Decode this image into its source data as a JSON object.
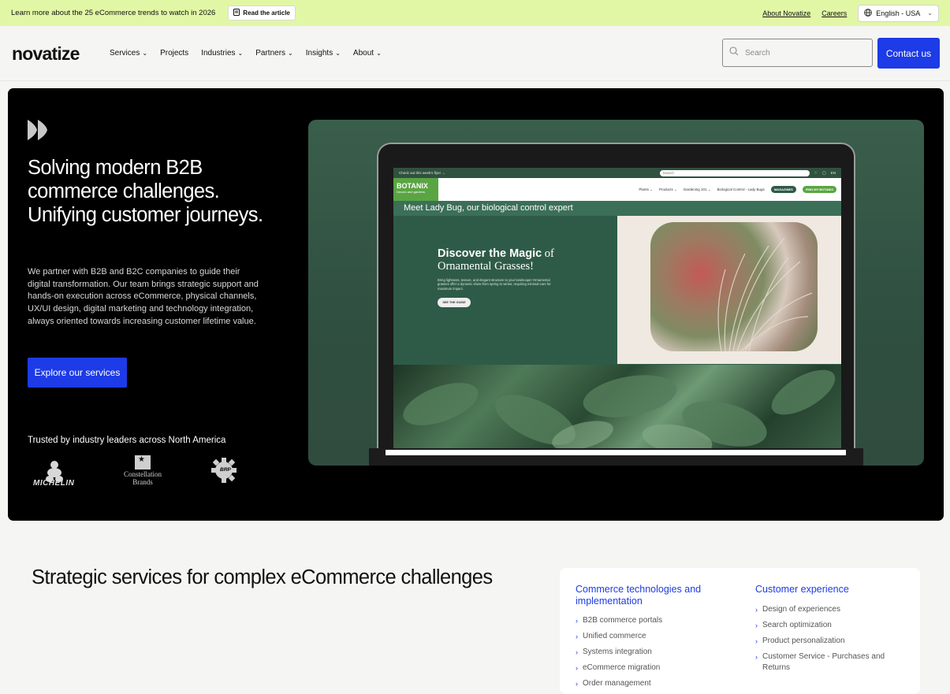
{
  "announcement": {
    "message": "Learn more about the 25 eCommerce trends to watch in 2026",
    "read_label": "Read the article",
    "links": [
      "About Novatize",
      "Careers"
    ],
    "language": "English - USA"
  },
  "header": {
    "logo": "novatize",
    "nav": [
      {
        "label": "Services",
        "has_dropdown": true
      },
      {
        "label": "Projects",
        "has_dropdown": false
      },
      {
        "label": "Industries",
        "has_dropdown": true
      },
      {
        "label": "Partners",
        "has_dropdown": true
      },
      {
        "label": "Insights",
        "has_dropdown": true
      },
      {
        "label": "About",
        "has_dropdown": true
      }
    ],
    "search_placeholder": "Search",
    "contact_label": "Contact us"
  },
  "hero": {
    "headline": "Solving modern B2B commerce challenges. Unifying customer journeys.",
    "body": "We partner with B2B and B2C companies to guide their digital transformation. Our team brings strategic support and hands-on execution across eCommerce, physical channels, UX/UI design, digital marketing and technology integration, always oriented towards increasing customer lifetime value.",
    "cta": "Explore our services",
    "trusted": "Trusted by industry leaders across North America",
    "brands": {
      "michelin": "MICHELIN",
      "constellation_1": "Constellation",
      "constellation_2": "Brands",
      "brp": "BRP"
    }
  },
  "mockup": {
    "topbar": "Check out this week's flyer →",
    "search": "Search",
    "store_name": "BOTANIX",
    "store_tagline": "Decors and gardens",
    "links": [
      "Plants ⌄",
      "Products ⌄",
      "Gardening 101 ⌄",
      "Biological Control - Lady Bugs"
    ],
    "magazines": "MAGAZINES",
    "find": "FIND MY BOTANIX",
    "lang": "EN",
    "banner": "Meet Lady Bug, our biological control expert",
    "promo_bold": "Discover the Magic",
    "promo_of": "of",
    "promo_line2": "Ornamental Grasses!",
    "promo_text": "Bring lightness, texture, and elegant structure to your landscape! Ornamental grasses offer a dynamic show from spring to winter, requiring minimal care for maximum impact.",
    "promo_btn": "SEE THE GUIDE"
  },
  "services": {
    "title": "Strategic services for complex eCommerce challenges",
    "columns": [
      {
        "heading": "Commerce technologies and implementation",
        "items": [
          "B2B commerce portals",
          "Unified commerce",
          "Systems integration",
          "eCommerce migration",
          "Order management"
        ]
      },
      {
        "heading": "Customer experience",
        "items": [
          "Design of experiences",
          "Search optimization",
          "Product personalization",
          "Customer Service - Purchases and Returns"
        ]
      }
    ]
  },
  "colors": {
    "accent": "#1d3be6",
    "announce_bg": "#e2f7a6",
    "hero_bg": "#000000",
    "botanix_green": "#5aa543"
  }
}
